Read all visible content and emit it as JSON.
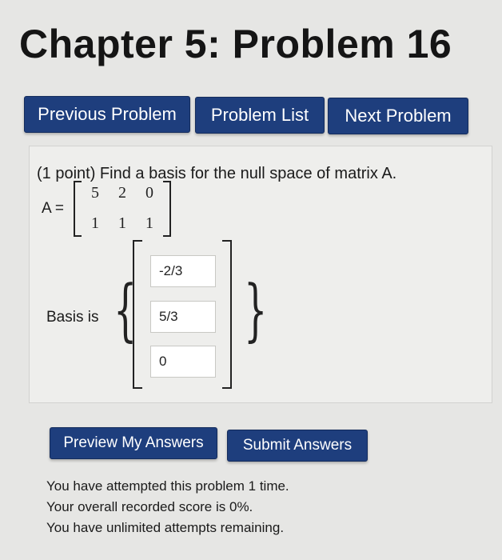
{
  "page": {
    "title": "Chapter 5: Problem 16"
  },
  "nav": {
    "previous": "Previous Problem",
    "list": "Problem List",
    "next": "Next Problem"
  },
  "problem": {
    "prompt": "(1 point) Find a basis for the null space of matrix A.",
    "matrix_label": "A =",
    "matrix": [
      [
        "5",
        "2",
        "0"
      ],
      [
        "1",
        "1",
        "1"
      ]
    ],
    "basis_label": "Basis is",
    "answers": [
      "-2/3",
      "5/3",
      "0"
    ]
  },
  "actions": {
    "preview": "Preview My Answers",
    "submit": "Submit Answers"
  },
  "status": [
    "You have attempted this problem 1 time.",
    "Your overall recorded score is 0%.",
    "You have unlimited attempts remaining."
  ],
  "colors": {
    "button_bg": "#1e3e7d",
    "page_bg": "#e6e6e4",
    "panel_bg": "#eeeeec"
  }
}
